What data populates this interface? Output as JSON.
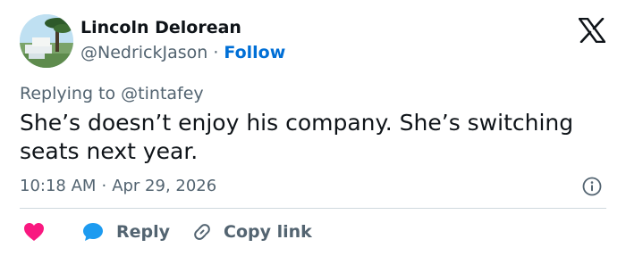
{
  "author": {
    "name": "Lincoln Delorean",
    "handle": "@NedrickJason",
    "separator": "·",
    "follow_label": "Follow"
  },
  "reply_context": {
    "prefix": "Replying to",
    "handle": "@tintafey"
  },
  "tweet": {
    "text": "She’s doesn’t enjoy his company. She’s switching seats next year."
  },
  "meta": {
    "time": "10:18 AM",
    "separator": "·",
    "date": "Apr 29, 2026"
  },
  "actions": {
    "reply_label": "Reply",
    "copy_link_label": "Copy link"
  },
  "icons": {
    "logo": "x-logo-icon",
    "info": "info-icon",
    "like": "heart-icon",
    "reply": "speech-bubble-icon",
    "copy_link": "link-icon"
  },
  "colors": {
    "text_primary": "#0f1419",
    "text_secondary": "#536471",
    "follow_blue": "#006fd6",
    "like_red": "#f91880",
    "reply_blue": "#1d9bf0",
    "divider": "#cfd9de"
  }
}
